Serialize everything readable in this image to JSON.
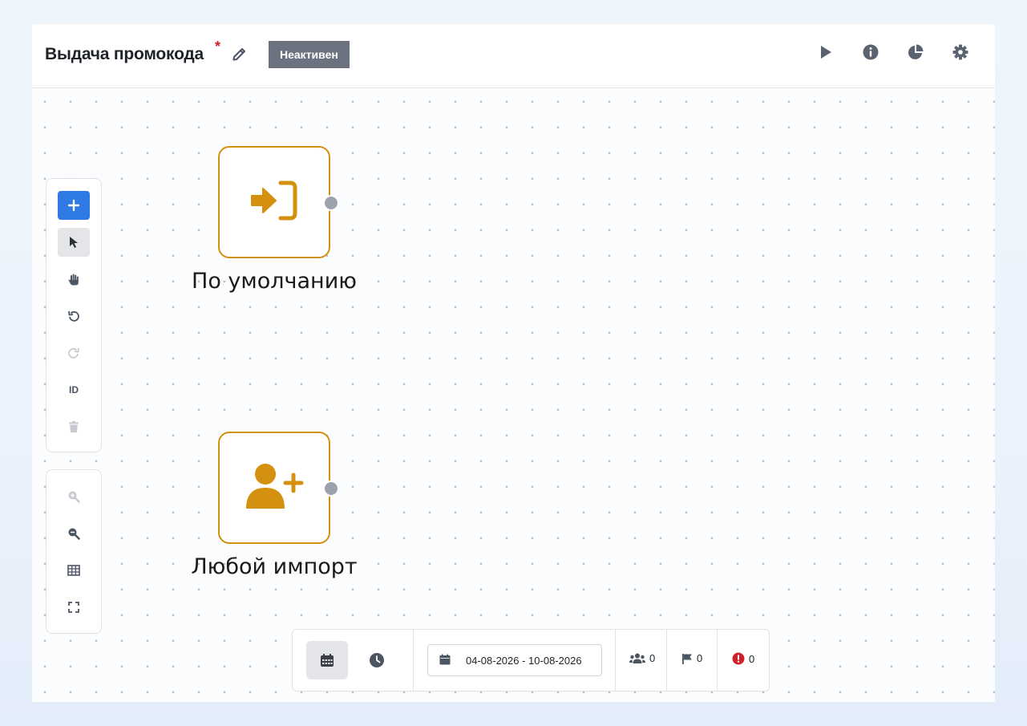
{
  "header": {
    "title": "Выдача промокода",
    "required_mark": "*",
    "status": "Неактивен",
    "icons": [
      "pencil-icon",
      "play-icon",
      "info-icon",
      "pie-chart-icon",
      "gear-icon"
    ]
  },
  "toolbar": {
    "tools": [
      "plus-icon",
      "cursor-icon",
      "hand-icon",
      "undo-icon",
      "redo-icon",
      "id-label",
      "trash-icon"
    ],
    "id_label": "ID",
    "zoom_tools": [
      "zoom-in-icon",
      "zoom-out-icon",
      "grid-icon",
      "fullscreen-icon"
    ]
  },
  "nodes": [
    {
      "label": "По умолчанию",
      "icon": "sign-in-icon"
    },
    {
      "label": "Любой импорт",
      "icon": "user-plus-icon"
    }
  ],
  "bottom_bar": {
    "date_range": "04-08-2026 - 10-08-2026",
    "users_count": "0",
    "flags_count": "0",
    "errors_count": "0"
  },
  "colors": {
    "node_accent": "#d4900f",
    "primary": "#2f7ae5",
    "status_badge": "#6b7280",
    "error": "#d0202a"
  }
}
